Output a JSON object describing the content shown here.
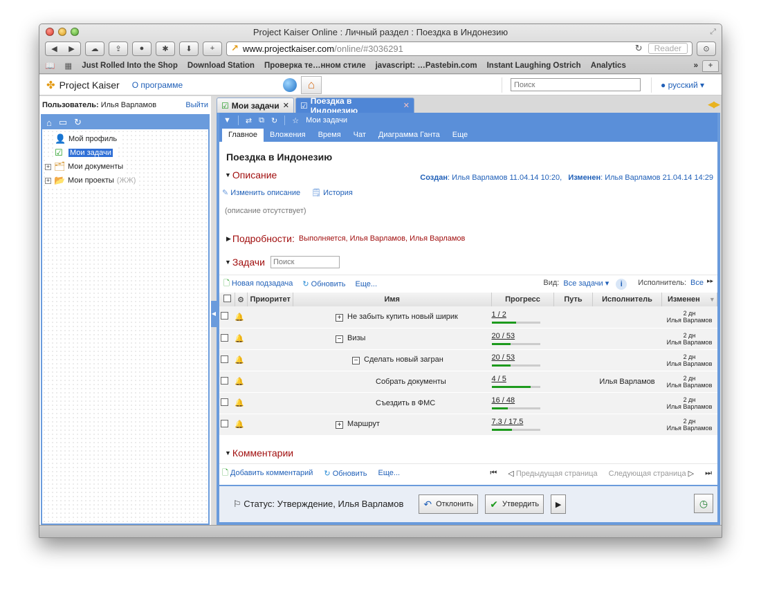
{
  "browser": {
    "title": "Project Kaiser Online : Личный раздел : Поездка в Индонезию",
    "url_host": "www.projectkaiser.com",
    "url_path": "/online/#3036291",
    "reader_label": "Reader",
    "bookmarks": [
      "Just Rolled Into the Shop",
      "Download Station",
      "Проверка те…нном стиле",
      "javascript: …Pastebin.com",
      "Instant Laughing Ostrich",
      "Analytics"
    ],
    "bookmarks_more": "»",
    "new_tab": "+"
  },
  "app": {
    "logo": "Project Kaiser",
    "about": "О программе",
    "search_placeholder": "Поиск",
    "language": "русский"
  },
  "user": {
    "label": "Пользователь:",
    "name": "Илья Варламов",
    "logout": "Выйти"
  },
  "tree": {
    "items": [
      {
        "label": "Мой профиль"
      },
      {
        "label": "Мои задачи"
      },
      {
        "label": "Мои документы"
      },
      {
        "label": "Мои проекты",
        "suffix": "(ЖЖ)"
      }
    ]
  },
  "tabs": [
    {
      "label": "Мои задачи"
    },
    {
      "label": "Поездка в Индонезию"
    }
  ],
  "subtool": {
    "breadcrumb": "Мои задачи"
  },
  "nav": [
    "Главное",
    "Вложения",
    "Время",
    "Чат",
    "Диаграмма Ганта",
    "Еще"
  ],
  "task": {
    "title": "Поездка в Индонезию",
    "description_header": "Описание",
    "created_label": "Создан",
    "created_value": ": Илья Варламов 11.04.14 10:20,",
    "changed_label": "Изменен",
    "changed_value": ": Илья Варламов 21.04.14 14:29",
    "edit_desc": "Изменить описание",
    "history": "История",
    "no_desc": "(описание отсутствует)",
    "details_header": "Подробности:",
    "details_value": "Выполняется, Илья Варламов, Илья Варламов"
  },
  "subtasks": {
    "header": "Задачи",
    "search_placeholder": "Поиск",
    "new_subtask": "Новая подзадача",
    "refresh": "Обновить",
    "more": "Еще...",
    "view_label": "Вид:",
    "view_value": "Все задачи",
    "assignee_label": "Исполнитель:",
    "assignee_value": "Все",
    "info": "i",
    "columns": [
      "Приоритет",
      "Имя",
      "Прогресс",
      "Путь",
      "Исполнитель",
      "Изменен"
    ],
    "rows": [
      {
        "name": "Не забыть купить новый ширик",
        "expand": "+",
        "progress": "1 / 2",
        "fraction": 0.5,
        "assignee": "",
        "changed_a": "2 дн",
        "changed_b": "Илья Варламов"
      },
      {
        "name": "Визы",
        "expand": "−",
        "progress": "20 / 53",
        "fraction": 0.38,
        "assignee": "",
        "changed_a": "2 дн",
        "changed_b": "Илья Варламов"
      },
      {
        "name": "Сделать новый загран",
        "expand": "−",
        "progress": "20 / 53",
        "fraction": 0.38,
        "assignee": "",
        "changed_a": "2 дн",
        "changed_b": "Илья Варламов"
      },
      {
        "name": "Собрать документы",
        "expand": "",
        "progress": "4 / 5",
        "fraction": 0.8,
        "assignee": "Илья Варламов",
        "changed_a": "2 дн",
        "changed_b": "Илья Варламов"
      },
      {
        "name": "Съездить в ФМС",
        "expand": "",
        "progress": "16 / 48",
        "fraction": 0.33,
        "assignee": "",
        "changed_a": "2 дн",
        "changed_b": "Илья Варламов"
      },
      {
        "name": "Маршрут",
        "expand": "+",
        "progress": "7.3 / 17.5",
        "fraction": 0.42,
        "assignee": "",
        "changed_a": "2 дн",
        "changed_b": "Илья Варламов"
      }
    ]
  },
  "comments": {
    "header": "Комментарии",
    "add": "Добавить комментарий",
    "refresh": "Обновить",
    "more": "Еще...",
    "prev": "Предыдущая страница",
    "next": "Следующая страница"
  },
  "status": {
    "text": "Статус: Утверждение, Илья Варламов",
    "reject": "Отклонить",
    "approve": "Утвердить"
  }
}
